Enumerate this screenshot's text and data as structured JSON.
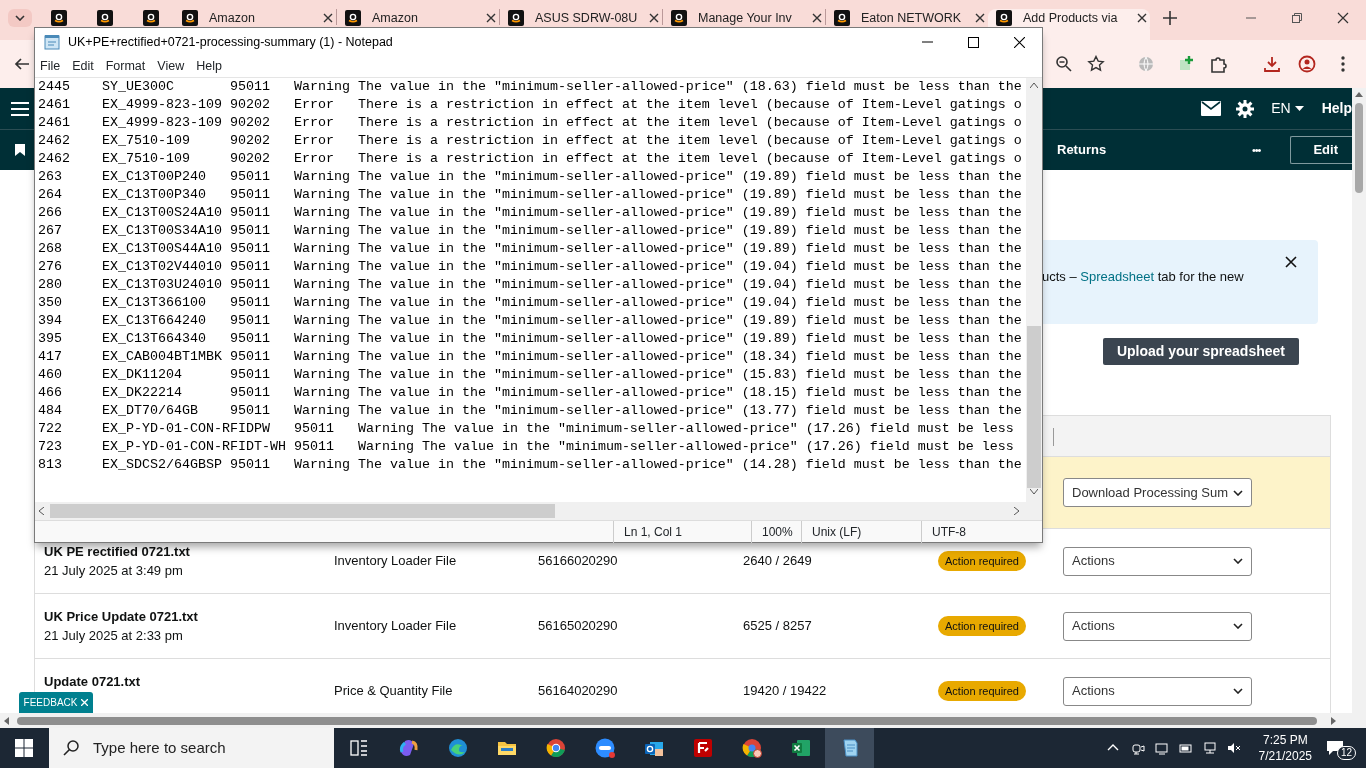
{
  "browser": {
    "tabs": [
      {
        "kind": "pinned",
        "selected": false
      },
      {
        "kind": "pinned",
        "selected": false
      },
      {
        "kind": "pinned",
        "selected": false
      },
      {
        "kind": "normal",
        "label": "Amazon",
        "selected": false
      },
      {
        "kind": "normal",
        "label": "Amazon",
        "selected": false
      },
      {
        "kind": "normal",
        "label": "ASUS SDRW-08U",
        "selected": false
      },
      {
        "kind": "normal",
        "label": "Manage Your Inv",
        "selected": false
      },
      {
        "kind": "normal",
        "label": "Eaton NETWORK",
        "selected": false
      },
      {
        "kind": "normal",
        "label": "Add Products via",
        "selected": true
      }
    ],
    "page": {
      "header": {
        "language": "EN",
        "help": "Help"
      },
      "subnav": {
        "link": "Returns",
        "more": "•••",
        "edit": "Edit"
      },
      "banner": {
        "text_before": "ucts – ",
        "link": "Spreadsheet",
        "text_after": " tab for the new"
      },
      "upload_button": "Upload your spreadsheet",
      "download_select": "Download Processing Sum",
      "rows": [
        {
          "name": "UK PE rectified 0721.txt",
          "date": "21 July 2025 at 3:49 pm",
          "file_type": "Inventory Loader File",
          "batch_id": "56166020290",
          "records": "2640 / 2649",
          "status": "Action required",
          "action": "Actions"
        },
        {
          "name": "UK Price Update 0721.txt",
          "date": "21 July 2025 at 2:33 pm",
          "file_type": "Inventory Loader File",
          "batch_id": "56165020290",
          "records": "6525 / 8257",
          "status": "Action required",
          "action": "Actions"
        },
        {
          "name": "Update 0721.txt",
          "file_type": "Price & Quantity File",
          "batch_id": "56164020290",
          "records": "19420 / 19422",
          "status": "Action required",
          "action": "Actions"
        }
      ],
      "feedback": "FEEDBACK"
    }
  },
  "notepad": {
    "title": "UK+PE+rectified+0721-processing-summary (1) - Notepad",
    "menu": [
      "File",
      "Edit",
      "Format",
      "View",
      "Help"
    ],
    "lines": [
      {
        "line": "2445",
        "sku": "SY_UE300C",
        "code": "95011",
        "type": "Warning",
        "message": "The value in the \"minimum-seller-allowed-price\" (18.63) field must be less than the"
      },
      {
        "line": "2461",
        "sku": "EX_4999-823-109",
        "code": "90202",
        "type": "Error",
        "message": "There is a restriction in effect at the item level (because of Item-Level gatings o"
      },
      {
        "line": "2461",
        "sku": "EX_4999-823-109",
        "code": "90202",
        "type": "Error",
        "message": "There is a restriction in effect at the item level (because of Item-Level gatings o"
      },
      {
        "line": "2462",
        "sku": "EX_7510-109",
        "code": "90202",
        "type": "Error",
        "message": "There is a restriction in effect at the item level (because of Item-Level gatings o"
      },
      {
        "line": "2462",
        "sku": "EX_7510-109",
        "code": "90202",
        "type": "Error",
        "message": "There is a restriction in effect at the item level (because of Item-Level gatings o"
      },
      {
        "line": "263",
        "sku": "EX_C13T00P240",
        "code": "95011",
        "type": "Warning",
        "message": "The value in the \"minimum-seller-allowed-price\" (19.89) field must be less than the"
      },
      {
        "line": "264",
        "sku": "EX_C13T00P340",
        "code": "95011",
        "type": "Warning",
        "message": "The value in the \"minimum-seller-allowed-price\" (19.89) field must be less than the"
      },
      {
        "line": "266",
        "sku": "EX_C13T00S24A10",
        "code": "95011",
        "type": "Warning",
        "message": "The value in the \"minimum-seller-allowed-price\" (19.89) field must be less than the"
      },
      {
        "line": "267",
        "sku": "EX_C13T00S34A10",
        "code": "95011",
        "type": "Warning",
        "message": "The value in the \"minimum-seller-allowed-price\" (19.89) field must be less than the"
      },
      {
        "line": "268",
        "sku": "EX_C13T00S44A10",
        "code": "95011",
        "type": "Warning",
        "message": "The value in the \"minimum-seller-allowed-price\" (19.89) field must be less than the"
      },
      {
        "line": "276",
        "sku": "EX_C13T02V44010",
        "code": "95011",
        "type": "Warning",
        "message": "The value in the \"minimum-seller-allowed-price\" (19.04) field must be less than the"
      },
      {
        "line": "280",
        "sku": "EX_C13T03U24010",
        "code": "95011",
        "type": "Warning",
        "message": "The value in the \"minimum-seller-allowed-price\" (19.04) field must be less than the"
      },
      {
        "line": "350",
        "sku": "EX_C13T366100",
        "code": "95011",
        "type": "Warning",
        "message": "The value in the \"minimum-seller-allowed-price\" (19.04) field must be less than the"
      },
      {
        "line": "394",
        "sku": "EX_C13T664240",
        "code": "95011",
        "type": "Warning",
        "message": "The value in the \"minimum-seller-allowed-price\" (19.89) field must be less than the"
      },
      {
        "line": "395",
        "sku": "EX_C13T664340",
        "code": "95011",
        "type": "Warning",
        "message": "The value in the \"minimum-seller-allowed-price\" (19.89) field must be less than the"
      },
      {
        "line": "417",
        "sku": "EX_CAB004BT1MBK",
        "code": "95011",
        "type": "Warning",
        "message": "The value in the \"minimum-seller-allowed-price\" (18.34) field must be less than the"
      },
      {
        "line": "460",
        "sku": "EX_DK11204",
        "code": "95011",
        "type": "Warning",
        "message": "The value in the \"minimum-seller-allowed-price\" (15.83) field must be less than the"
      },
      {
        "line": "466",
        "sku": "EX_DK22214",
        "code": "95011",
        "type": "Warning",
        "message": "The value in the \"minimum-seller-allowed-price\" (18.15) field must be less than the"
      },
      {
        "line": "484",
        "sku": "EX_DT70/64GB",
        "code": "95011",
        "type": "Warning",
        "message": "The value in the \"minimum-seller-allowed-price\" (13.77) field must be less than the"
      },
      {
        "line": "722",
        "sku": "EX_P-YD-01-CON-RFIDPW",
        "code": "95011",
        "type": "Warning",
        "message": "The value in the \"minimum-seller-allowed-price\" (17.26) field must be less"
      },
      {
        "line": "723",
        "sku": "EX_P-YD-01-CON-RFIDT-WH",
        "code": "95011",
        "type": "Warning",
        "message": "The value in the \"minimum-seller-allowed-price\" (17.26) field must be less"
      },
      {
        "line": "813",
        "sku": "EX_SDCS2/64GBSP",
        "code": "95011",
        "type": "Warning",
        "message": "The value in the \"minimum-seller-allowed-price\" (14.28) field must be less than the"
      }
    ],
    "status": [
      "Ln 1, Col 1",
      "100%",
      "Unix (LF)",
      "UTF-8"
    ]
  },
  "taskbar": {
    "search_placeholder": "Type here to search",
    "apps": [
      {
        "kind": "copilot",
        "active": false
      },
      {
        "kind": "edge",
        "active": false
      },
      {
        "kind": "explorer",
        "active": false
      },
      {
        "kind": "chrome",
        "active": false
      },
      {
        "kind": "zoom",
        "active": false
      },
      {
        "kind": "outlook",
        "active": false
      },
      {
        "kind": "filezilla",
        "active": false
      },
      {
        "kind": "chrome-profile",
        "active": false
      },
      {
        "kind": "excel",
        "active": false
      },
      {
        "kind": "notepad",
        "active": true
      }
    ],
    "time": "7:25 PM",
    "date": "7/21/2025",
    "notifications": "12"
  }
}
